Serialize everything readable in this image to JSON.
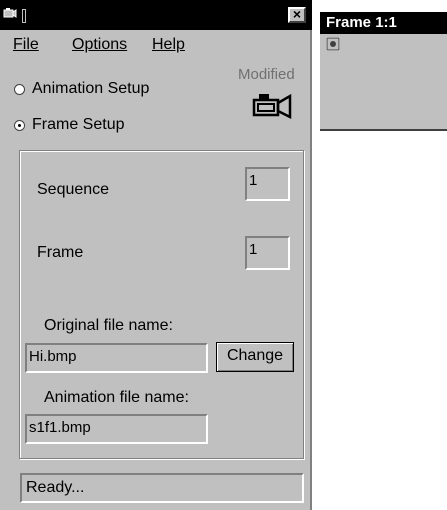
{
  "menu": {
    "file": "File",
    "options": "Options",
    "help": "Help"
  },
  "mode": {
    "animation_setup": "Animation Setup",
    "frame_setup": "Frame Setup",
    "selected": "Frame Setup"
  },
  "status_modified": "Modified",
  "sequence": {
    "label": "Sequence",
    "value": "1"
  },
  "frame": {
    "label": "Frame",
    "value": "1"
  },
  "original_file": {
    "label": "Original file name:",
    "value": "Hi.bmp",
    "button": "Change"
  },
  "animation_file": {
    "label": "Animation file name:",
    "value": "s1f1.bmp"
  },
  "status_bar": "Ready...",
  "frame_window": {
    "title": "Frame 1:1"
  },
  "icons": [
    "camera-icon",
    "close-icon",
    "app-icon"
  ]
}
